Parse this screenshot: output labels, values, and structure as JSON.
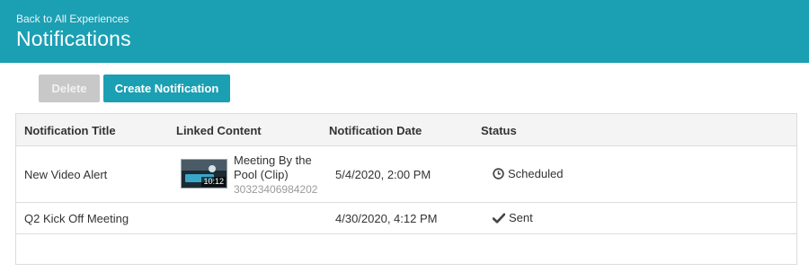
{
  "header": {
    "back_link": "Back to All Experiences",
    "title": "Notifications"
  },
  "toolbar": {
    "delete_label": "Delete",
    "create_label": "Create Notification"
  },
  "table": {
    "columns": [
      "Notification Title",
      "Linked Content",
      "Notification Date",
      "Status"
    ],
    "rows": [
      {
        "title": "New Video Alert",
        "linked_content": {
          "title": "Meeting By the Pool (Clip)",
          "id": "30323406984202",
          "duration": "10:12"
        },
        "date": "5/4/2020, 2:00 PM",
        "status": "Scheduled",
        "status_icon": "clock-icon"
      },
      {
        "title": "Q2 Kick Off Meeting",
        "date": "4/30/2020, 4:12 PM",
        "status": "Sent",
        "status_icon": "check-icon"
      }
    ]
  },
  "colors": {
    "accent": "#1b9fb3",
    "disabled": "#c8c8c8"
  }
}
